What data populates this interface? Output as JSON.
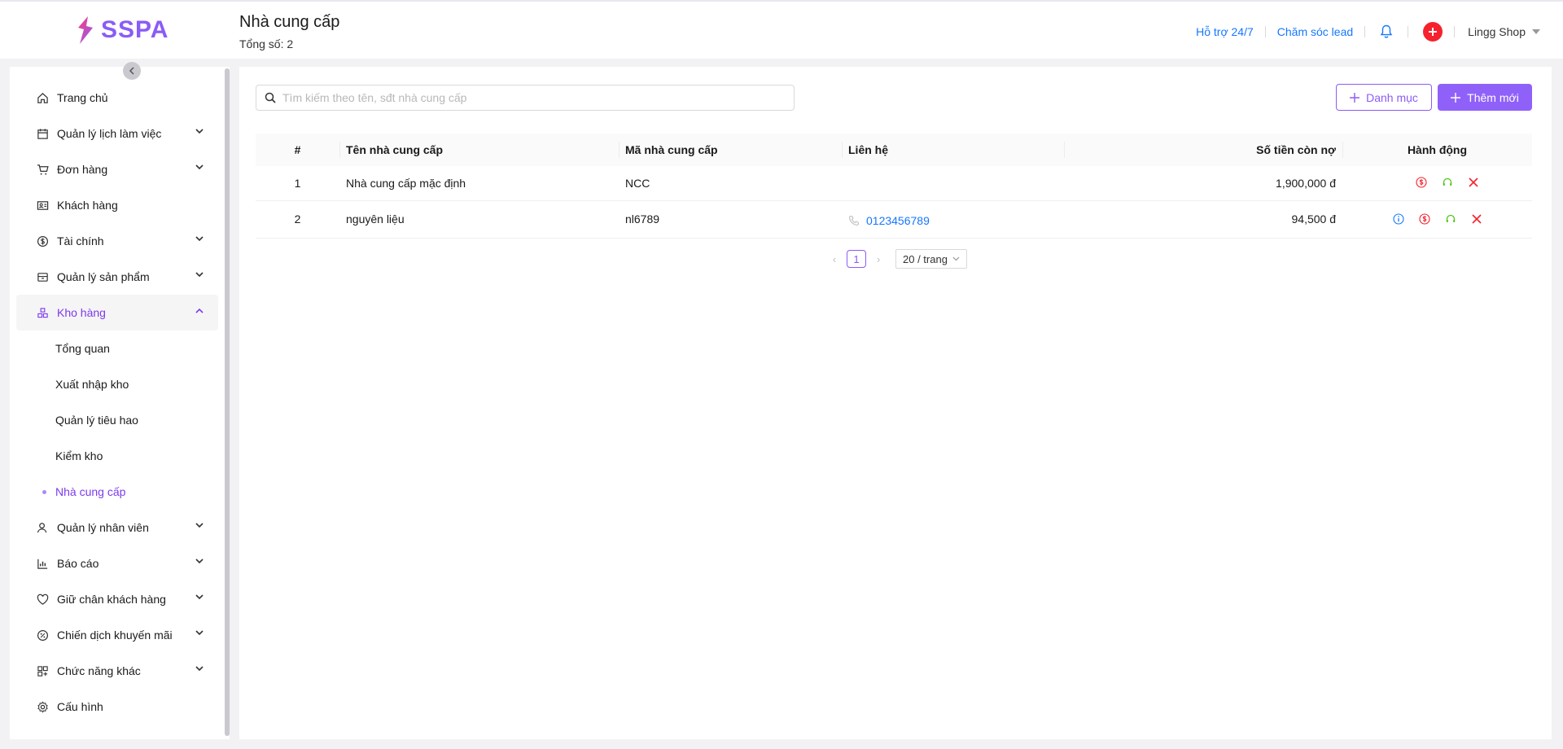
{
  "brand": {
    "name": "SSPA",
    "color": "#8a5cf6"
  },
  "header": {
    "title": "Nhà cung cấp",
    "subtitle": "Tổng số: 2",
    "links": {
      "support": "Hỗ trợ 24/7",
      "lead": "Chăm sóc lead"
    },
    "user": "Lingg Shop"
  },
  "sidebar": {
    "items": [
      {
        "label": "Trang chủ",
        "icon": "home-icon"
      },
      {
        "label": "Quản lý lịch làm việc",
        "icon": "calendar-icon"
      },
      {
        "label": "Đơn hàng",
        "icon": "cart-icon"
      },
      {
        "label": "Khách hàng",
        "icon": "customer-card-icon"
      },
      {
        "label": "Tài chính",
        "icon": "dollar-icon"
      },
      {
        "label": "Quản lý sản phẩm",
        "icon": "box-icon"
      },
      {
        "label": "Kho hàng",
        "icon": "warehouse-icon"
      },
      {
        "label": "Quản lý nhân viên",
        "icon": "staff-icon"
      },
      {
        "label": "Báo cáo",
        "icon": "chart-icon"
      },
      {
        "label": "Giữ chân khách hàng",
        "icon": "heart-icon"
      },
      {
        "label": "Chiến dịch khuyến mãi",
        "icon": "percent-icon"
      },
      {
        "label": "Chức năng khác",
        "icon": "grid-icon"
      },
      {
        "label": "Cấu hình",
        "icon": "settings-icon"
      }
    ],
    "warehouse_sub": [
      {
        "label": "Tổng quan"
      },
      {
        "label": "Xuất nhập kho"
      },
      {
        "label": "Quản lý tiêu hao"
      },
      {
        "label": "Kiểm kho"
      },
      {
        "label": "Nhà cung cấp"
      }
    ]
  },
  "toolbar": {
    "search_placeholder": "Tìm kiếm theo tên, sđt nhà cung cấp",
    "category_label": "Danh mục",
    "add_label": "Thêm mới",
    "accent": "#8b5cf6"
  },
  "table": {
    "columns": [
      "#",
      "Tên nhà cung cấp",
      "Mã nhà cung cấp",
      "Liên hệ",
      "Số tiền còn nợ",
      "Hành động"
    ],
    "rows": [
      {
        "index": "1",
        "name": "Nhà cung cấp mặc định",
        "code": "NCC",
        "phone": "",
        "debt": "1,900,000 đ"
      },
      {
        "index": "2",
        "name": "nguyên liệu",
        "code": "nl6789",
        "phone": "0123456789",
        "debt": "94,500 đ"
      }
    ]
  },
  "pagination": {
    "current": "1",
    "page_size": "20 / trang"
  }
}
